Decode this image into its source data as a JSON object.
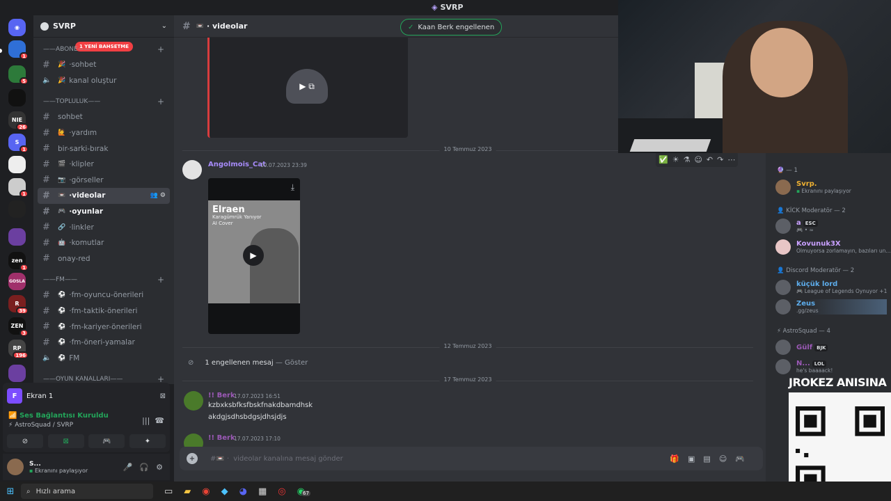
{
  "window": {
    "title": "SVRP"
  },
  "rail": {
    "servers": [
      {
        "label": "",
        "badge": "1"
      },
      {
        "label": "",
        "badge": "5"
      },
      {
        "label": "",
        "badge": ""
      },
      {
        "label": "NIE",
        "badge": "26"
      },
      {
        "label": "S",
        "badge": "1"
      },
      {
        "label": "",
        "badge": ""
      },
      {
        "label": "",
        "badge": "1"
      },
      {
        "label": "",
        "badge": ""
      },
      {
        "label": "",
        "badge": ""
      },
      {
        "label": "zen",
        "badge": "1"
      },
      {
        "label": "GOSLA",
        "badge": ""
      },
      {
        "label": "R",
        "badge": "39"
      },
      {
        "label": "ZEN",
        "badge": "3"
      },
      {
        "label": "RP",
        "badge": "196"
      }
    ]
  },
  "sidebar": {
    "guild_name": "SVRP",
    "mention_badge": "1 YENİ BAHSETME",
    "categories": [
      {
        "label": "ABONE",
        "channels": [
          {
            "name": "sohbet",
            "emoji": "🎉",
            "type": "text"
          },
          {
            "name": "kanal oluştur",
            "emoji": "🎉",
            "type": "voice"
          }
        ]
      },
      {
        "label": "TOPLULUK",
        "channels": [
          {
            "name": "sohbet",
            "emoji": "",
            "type": "text"
          },
          {
            "name": "yardım",
            "emoji": "🙋",
            "type": "text"
          },
          {
            "name": "bir-sarki-bırak",
            "emoji": "",
            "type": "text"
          },
          {
            "name": "klipler",
            "emoji": "🎬",
            "type": "text"
          },
          {
            "name": "görseller",
            "emoji": "📷",
            "type": "text"
          },
          {
            "name": "videolar",
            "emoji": "📼",
            "type": "text",
            "active": true
          },
          {
            "name": "oyunlar",
            "emoji": "🎮",
            "type": "text",
            "unread": true
          },
          {
            "name": "linkler",
            "emoji": "🔗",
            "type": "text"
          },
          {
            "name": "komutlar",
            "emoji": "🤖",
            "type": "text"
          },
          {
            "name": "onay-red",
            "emoji": "",
            "type": "text"
          }
        ]
      },
      {
        "label": "FM",
        "channels": [
          {
            "name": "fm-oyuncu-önerileri",
            "emoji": "⚽",
            "type": "text"
          },
          {
            "name": "fm-taktik-önerileri",
            "emoji": "⚽",
            "type": "text"
          },
          {
            "name": "fm-kariyer-önerileri",
            "emoji": "⚽",
            "type": "text"
          },
          {
            "name": "fm-öneri-yamalar",
            "emoji": "⚽",
            "type": "text"
          },
          {
            "name": "FM",
            "emoji": "⚽",
            "type": "voice"
          }
        ]
      },
      {
        "label": "OYUN KANALLARI",
        "channels": []
      }
    ]
  },
  "voice": {
    "screen_label": "Ekran 1",
    "status": "Ses Bağlantısı Kuruldu",
    "location": "AstroSquad / SVRP"
  },
  "user": {
    "name": "S...",
    "status": "Ekranını paylaşıyor"
  },
  "chat": {
    "channel": "videolar",
    "toast": "Kaan Berk engellenen",
    "dividers": [
      "10 Temmuz 2023",
      "12 Temmuz 2023",
      "17 Temmuz 2023"
    ],
    "message1": {
      "author": "Angolmois_Cat",
      "time": "10.07.2023 23:39",
      "author_color": "#a78bfa"
    },
    "video": {
      "title": "Elraen",
      "line2": "Karagümrük Yanıyor",
      "line3": "AI Cover"
    },
    "blocked": {
      "text": "1 engellenen mesaj",
      "sep": " — ",
      "action": "Göster"
    },
    "message2": {
      "author": "Berk",
      "time": "17.07.2023 16:51",
      "lines": [
        "kzbxksbfksfbskfnakdbamdhsk",
        "akdgjsdhsbdgsjdhsjdjs"
      ],
      "author_color": "#9b59b6"
    },
    "message3": {
      "author": "Berk",
      "time": "17.07.2023 17:10"
    },
    "composer_placeholder": "videolar kanalına mesaj gönder"
  },
  "members": {
    "groups": [
      {
        "label": "— 1",
        "members": [
          {
            "name": "Svrp.",
            "status": "Ekranını paylaşıyor",
            "color": "#f0b232"
          }
        ]
      },
      {
        "label": "KİCK Moderatör — 2",
        "members": [
          {
            "name": "a",
            "status": "",
            "tag": "ESC",
            "color": "#c9a0ff"
          },
          {
            "name": "Kovunuk3X",
            "status": "Olmuyorsa zorlamayın, bazıları un...",
            "color": "#c9a0ff"
          }
        ]
      },
      {
        "label": "Discord Moderatör — 2",
        "members": [
          {
            "name": "küçük lord",
            "status": "League of Legends Oynuyor +1",
            "color": "#5dadec"
          },
          {
            "name": "Zeus",
            "status": ".gg/zeus",
            "color": "#5dadec"
          }
        ]
      },
      {
        "label": "AstroSquad — 4",
        "members": [
          {
            "name": "Gülf",
            "status": "",
            "tag": "BJK",
            "color": "#9b59b6"
          },
          {
            "name": "N...",
            "status": "he's baaaack!",
            "tag": "LOL",
            "color": "#9b59b6"
          }
        ]
      }
    ]
  },
  "overlay": {
    "qr_title": "JROKEZ ANISINA"
  },
  "taskbar": {
    "search_placeholder": "Hızlı arama",
    "whatsapp_badge": "67"
  }
}
